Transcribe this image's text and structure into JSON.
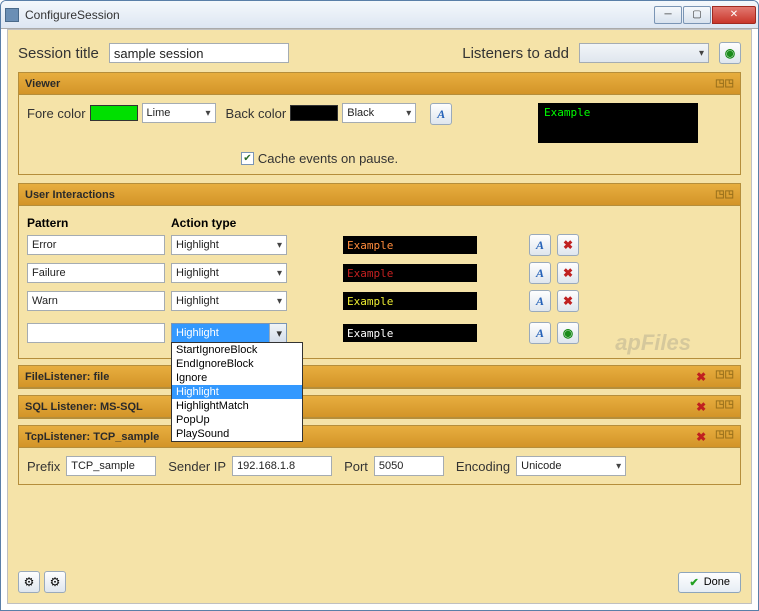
{
  "window": {
    "title": "ConfigureSession"
  },
  "topbar": {
    "session_title_label": "Session title",
    "session_title_value": "sample session",
    "listeners_label": "Listeners to add",
    "listeners_value": ""
  },
  "viewer": {
    "header": "Viewer",
    "fore_label": "Fore color",
    "fore_value": "Lime",
    "back_label": "Back color",
    "back_value": "Black",
    "cache_label": "Cache events on pause.",
    "preview_text": "Example"
  },
  "interactions": {
    "header": "User Interactions",
    "col_pattern": "Pattern",
    "col_action": "Action type",
    "rows": [
      {
        "pattern": "Error",
        "action": "Highlight",
        "color": "#ff8c3c",
        "example": "Example"
      },
      {
        "pattern": "Failure",
        "action": "Highlight",
        "color": "#c42020",
        "example": "Example"
      },
      {
        "pattern": "Warn",
        "action": "Highlight",
        "color": "#eeee33",
        "example": "Example"
      }
    ],
    "newrow": {
      "pattern": "",
      "action": "Highlight",
      "color": "#ffffff",
      "example": "Example"
    },
    "options": [
      "StartIgnoreBlock",
      "EndIgnoreBlock",
      "Ignore",
      "Highlight",
      "HighlightMatch",
      "PopUp",
      "PlaySound"
    ]
  },
  "listeners": {
    "file": {
      "header": "FileListener: file"
    },
    "sql": {
      "header": "SQL Listener: MS-SQL"
    },
    "tcp": {
      "header": "TcpListener: TCP_sample",
      "prefix_label": "Prefix",
      "prefix_value": "TCP_sample",
      "senderip_label": "Sender IP",
      "senderip_value": "192.168.1.8",
      "port_label": "Port",
      "port_value": "5050",
      "encoding_label": "Encoding",
      "encoding_value": "Unicode"
    }
  },
  "footer": {
    "done": "Done"
  },
  "colors": {
    "lime": "#00e000",
    "black": "#000000"
  }
}
